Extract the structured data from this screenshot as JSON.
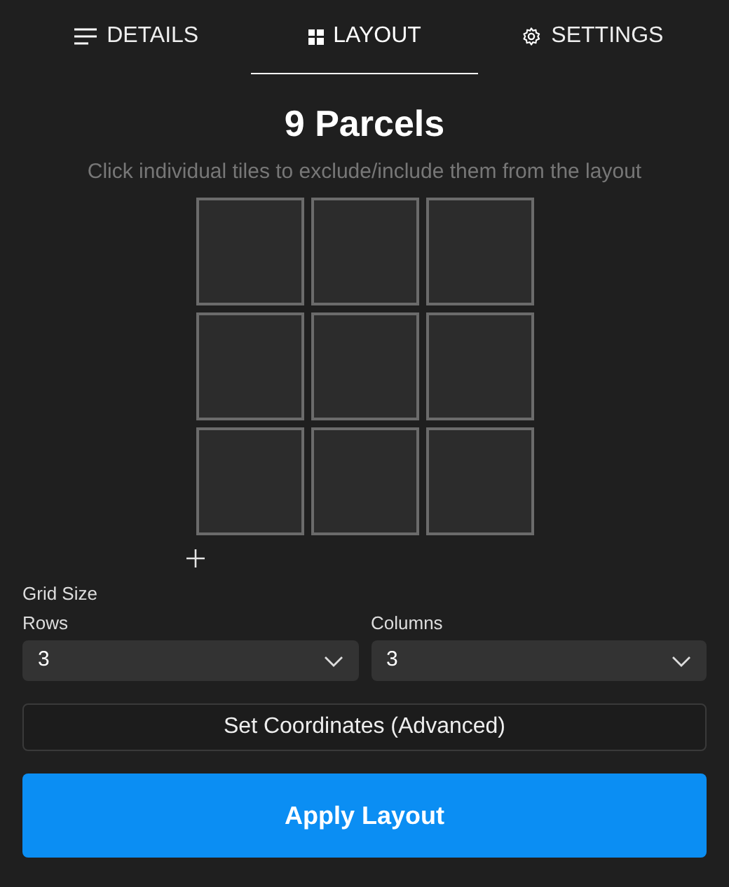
{
  "tabs": [
    {
      "label": "DETAILS",
      "kind": "details",
      "selected": false
    },
    {
      "label": "LAYOUT",
      "kind": "layout",
      "selected": true
    },
    {
      "label": "SETTINGS",
      "kind": "settings",
      "selected": false
    }
  ],
  "title": "9 Parcels",
  "hint": "Click individual tiles to exclude/include them from the layout",
  "tiles": [
    {
      "included": true
    },
    {
      "included": true
    },
    {
      "included": true
    },
    {
      "included": true
    },
    {
      "included": true
    },
    {
      "included": true
    },
    {
      "included": true
    },
    {
      "included": true
    },
    {
      "included": true
    }
  ],
  "grid_size": {
    "label": "Grid Size",
    "rows": {
      "label": "Rows",
      "value": "3"
    },
    "columns": {
      "label": "Columns",
      "value": "3"
    }
  },
  "buttons": [
    {
      "label": "Set Coordinates (Advanced)",
      "kind": "secondary"
    },
    {
      "label": "Apply Layout",
      "kind": "primary"
    }
  ]
}
